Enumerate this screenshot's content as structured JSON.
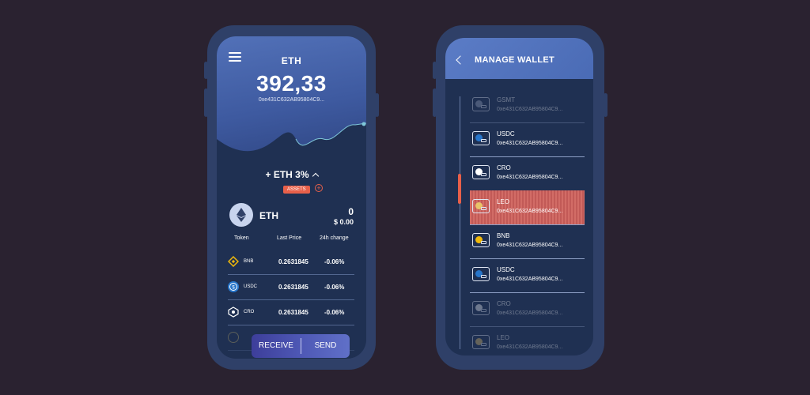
{
  "wallet_screen": {
    "title": "ETH",
    "balance": "392,33",
    "address": "0xe431C632AB95804C9...",
    "change": "+ ETH 3%",
    "assets_label": "ASSETS",
    "asset": {
      "name": "ETH",
      "amount": "0",
      "usd": "$ 0.00"
    },
    "columns": {
      "token": "Token",
      "last_price": "Last Price",
      "change": "24h change"
    },
    "tokens": [
      {
        "symbol": "BNB",
        "price": "0.2631845",
        "change": "-0.06%",
        "color": "#f0b90b"
      },
      {
        "symbol": "USDC",
        "price": "0.2631845",
        "change": "-0.06%",
        "color": "#2775ca"
      },
      {
        "symbol": "CRO",
        "price": "0.2631845",
        "change": "-0.06%",
        "color": "#0e2a5a"
      }
    ],
    "actions": {
      "receive": "RECEIVE",
      "send": "SEND"
    }
  },
  "manage_screen": {
    "title": "MANAGE WALLET",
    "wallets": [
      {
        "name": "GSMT",
        "address": "0xe431C632AB95804C9...",
        "faded": true
      },
      {
        "name": "USDC",
        "address": "0xe431C632AB95804C9...",
        "faded": false
      },
      {
        "name": "CRO",
        "address": "0xe431C632AB95804C9...",
        "faded": false
      },
      {
        "name": "LEO",
        "address": "0xe431C632AB95804C9...",
        "faded": false,
        "active": true
      },
      {
        "name": "BNB",
        "address": "0xe431C632AB95804C9...",
        "faded": false
      },
      {
        "name": "USDC",
        "address": "0xe431C632AB95804C9...",
        "faded": false
      },
      {
        "name": "CRO",
        "address": "0xe431C632AB95804C9...",
        "faded": true
      },
      {
        "name": "LEO",
        "address": "0xe431C632AB95804C9...",
        "faded": true
      }
    ]
  },
  "colors": {
    "accent": "#e8604a",
    "background": "#2a2230",
    "panel": "#1f3052"
  }
}
